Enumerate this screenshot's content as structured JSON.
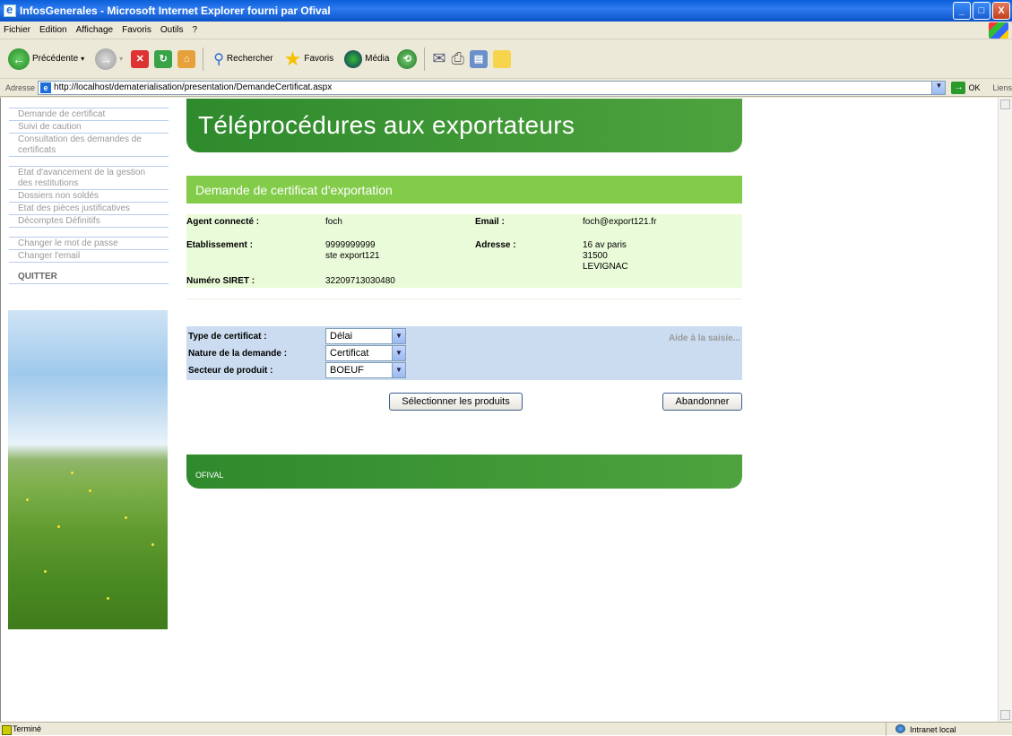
{
  "window": {
    "title": "InfosGenerales - Microsoft Internet Explorer fourni par Ofival",
    "controls": {
      "minimize": "_",
      "maximize": "□",
      "close": "X"
    }
  },
  "menu": [
    "Fichier",
    "Edition",
    "Affichage",
    "Favoris",
    "Outils",
    "?"
  ],
  "toolbar": {
    "back": "Précédente",
    "search": "Rechercher",
    "favorites": "Favoris",
    "media": "Média"
  },
  "address": {
    "label": "Adresse",
    "url": "http://localhost/dematerialisation/presentation/DemandeCertificat.aspx",
    "go": "OK",
    "links": "Liens"
  },
  "sidebar": {
    "group1": [
      "Demande de certificat",
      "Suivi de caution",
      "Consultation des demandes de certificats"
    ],
    "group2": [
      "Etat d'avancement de la gestion des restitutions",
      "Dossiers non soldés",
      "Etat des pièces justificatives",
      "Décomptes Définitifs"
    ],
    "group3": [
      "Changer le mot de passe",
      "Changer l'email"
    ],
    "quit": "QUITTER"
  },
  "banner": {
    "title": "Téléprocédures aux exportateurs"
  },
  "section": {
    "title": "Demande de certificat d'exportation"
  },
  "info": {
    "agent_label": "Agent connecté :",
    "agent_value": "foch",
    "email_label": "Email :",
    "email_value": "foch@export121.fr",
    "etab_label": "Etablissement :",
    "etab_line1": "9999999999",
    "etab_line2": "ste export121",
    "address_label": "Adresse :",
    "address_line1": "16 av paris",
    "address_line2": "31500",
    "address_line3": "LEVIGNAC",
    "siret_label": "Numéro SIRET :",
    "siret_value": "32209713030480"
  },
  "form": {
    "type_label": "Type de certificat :",
    "type_value": "Délai",
    "nature_label": "Nature de la demande :",
    "nature_value": "Certificat",
    "secteur_label": "Secteur de produit :",
    "secteur_value": "BOEUF",
    "help": "Aide à la saisie..."
  },
  "buttons": {
    "select_products": "Sélectionner les produits",
    "abandon": "Abandonner"
  },
  "footer": {
    "text": "OFIVAL"
  },
  "status": {
    "left": "Terminé",
    "zone": "Intranet local"
  }
}
